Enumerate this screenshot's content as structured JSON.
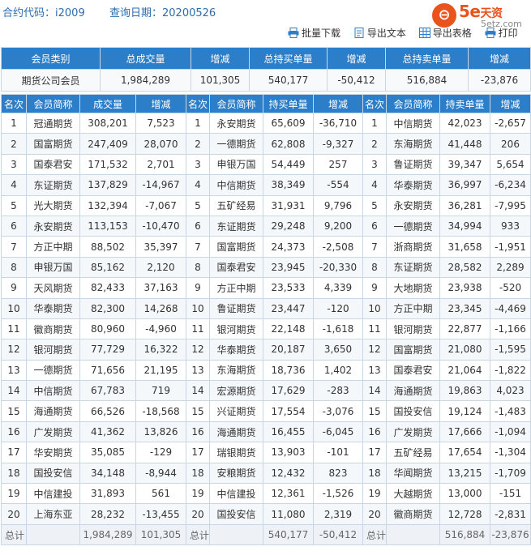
{
  "query": {
    "contract_label": "合约代码：",
    "contract_code": "i2009",
    "date_label": "查询日期：",
    "date": "20200526"
  },
  "logo": {
    "glyph": "⊖",
    "brand": "5e",
    "brand_cn": "天资",
    "site": "5etz.com"
  },
  "toolbar": {
    "batch_download": "批量下载",
    "export_text": "导出文本",
    "export_table": "导出表格",
    "print": "打印"
  },
  "summary": {
    "headers": [
      "会员类别",
      "总成交量",
      "增减",
      "总持买单量",
      "增减",
      "总持卖单量",
      "增减"
    ],
    "row": [
      "期货公司会员",
      "1,984,289",
      "101,305",
      "540,177",
      "-50,412",
      "516,884",
      "-23,876"
    ]
  },
  "ranking": {
    "headers": [
      "名次",
      "会员简称",
      "成交量",
      "增减",
      "名次",
      "会员简称",
      "持买单量",
      "增减",
      "名次",
      "会员简称",
      "持卖单量",
      "增减"
    ],
    "rows": [
      [
        "1",
        "冠通期货",
        "308,201",
        "7,523",
        "1",
        "永安期货",
        "65,609",
        "-36,710",
        "1",
        "中信期货",
        "42,023",
        "-2,657"
      ],
      [
        "2",
        "国富期货",
        "247,409",
        "28,070",
        "2",
        "一德期货",
        "62,808",
        "-9,327",
        "2",
        "东海期货",
        "41,448",
        "206"
      ],
      [
        "3",
        "国泰君安",
        "171,532",
        "2,701",
        "3",
        "申银万国",
        "54,449",
        "257",
        "3",
        "鲁证期货",
        "39,347",
        "5,654"
      ],
      [
        "4",
        "东证期货",
        "137,829",
        "-14,967",
        "4",
        "中信期货",
        "38,349",
        "-554",
        "4",
        "华泰期货",
        "36,997",
        "-6,234"
      ],
      [
        "5",
        "光大期货",
        "132,394",
        "-7,067",
        "5",
        "五矿经易",
        "31,931",
        "9,796",
        "5",
        "永安期货",
        "36,281",
        "-7,995"
      ],
      [
        "6",
        "永安期货",
        "113,153",
        "-10,470",
        "6",
        "东证期货",
        "29,248",
        "9,200",
        "6",
        "一德期货",
        "34,994",
        "933"
      ],
      [
        "7",
        "方正中期",
        "88,502",
        "35,397",
        "7",
        "国富期货",
        "24,373",
        "-2,508",
        "7",
        "浙商期货",
        "31,658",
        "-1,951"
      ],
      [
        "8",
        "申银万国",
        "85,162",
        "2,120",
        "8",
        "国泰君安",
        "23,945",
        "-20,330",
        "8",
        "东证期货",
        "28,582",
        "2,289"
      ],
      [
        "9",
        "天风期货",
        "82,433",
        "37,163",
        "9",
        "方正中期",
        "23,533",
        "4,339",
        "9",
        "大地期货",
        "23,938",
        "-520"
      ],
      [
        "10",
        "华泰期货",
        "82,300",
        "14,268",
        "10",
        "鲁证期货",
        "23,447",
        "-120",
        "10",
        "方正中期",
        "23,345",
        "-4,469"
      ],
      [
        "11",
        "徽商期货",
        "80,960",
        "-4,960",
        "11",
        "银河期货",
        "22,148",
        "-1,618",
        "11",
        "银河期货",
        "22,877",
        "-1,166"
      ],
      [
        "12",
        "银河期货",
        "77,729",
        "16,322",
        "12",
        "华泰期货",
        "20,187",
        "3,650",
        "12",
        "国富期货",
        "21,080",
        "-1,595"
      ],
      [
        "13",
        "一德期货",
        "71,656",
        "21,195",
        "13",
        "东海期货",
        "18,736",
        "1,402",
        "13",
        "国泰君安",
        "21,064",
        "-1,822"
      ],
      [
        "14",
        "中信期货",
        "67,783",
        "719",
        "14",
        "宏源期货",
        "17,629",
        "-283",
        "14",
        "海通期货",
        "19,863",
        "4,023"
      ],
      [
        "15",
        "海通期货",
        "66,526",
        "-18,568",
        "15",
        "兴证期货",
        "17,554",
        "-3,076",
        "15",
        "国投安信",
        "19,124",
        "-1,483"
      ],
      [
        "16",
        "广发期货",
        "41,362",
        "13,826",
        "16",
        "海通期货",
        "16,455",
        "-6,045",
        "16",
        "广发期货",
        "17,666",
        "-1,094"
      ],
      [
        "17",
        "华安期货",
        "35,085",
        "-129",
        "17",
        "瑞银期货",
        "13,903",
        "-101",
        "17",
        "五矿经易",
        "17,654",
        "-1,304"
      ],
      [
        "18",
        "国投安信",
        "34,148",
        "-8,944",
        "18",
        "安粮期货",
        "12,432",
        "823",
        "18",
        "华闻期货",
        "13,215",
        "-1,709"
      ],
      [
        "19",
        "中信建投",
        "31,893",
        "561",
        "19",
        "中信建投",
        "12,361",
        "-1,526",
        "19",
        "大越期货",
        "13,000",
        "-151"
      ],
      [
        "20",
        "上海东亚",
        "28,232",
        "-13,455",
        "20",
        "国投安信",
        "11,080",
        "2,319",
        "20",
        "徽商期货",
        "12,728",
        "-2,831"
      ]
    ],
    "total": [
      "总计",
      "",
      "1,984,289",
      "101,305",
      "总计",
      "",
      "540,177",
      "-50,412",
      "总计",
      "",
      "516,884",
      "-23,876"
    ]
  }
}
